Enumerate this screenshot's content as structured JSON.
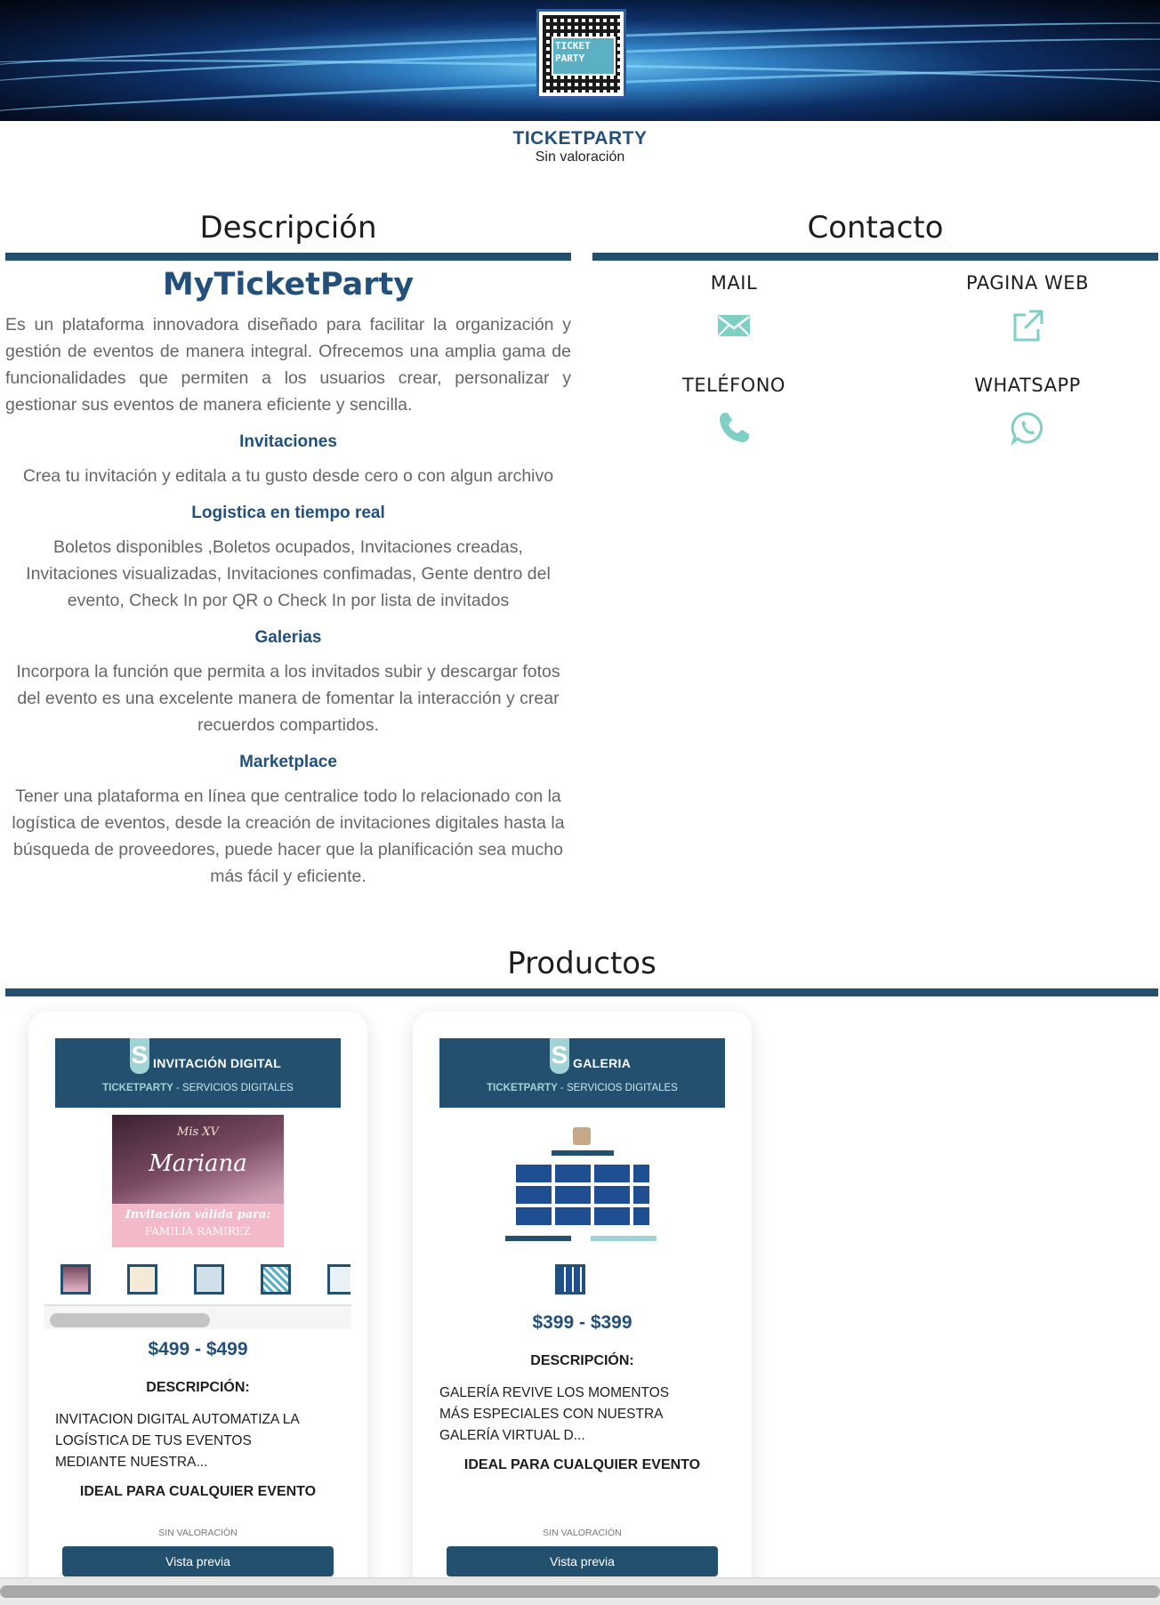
{
  "store": {
    "name": "TICKETPARTY",
    "rating": "Sin valoración"
  },
  "logo": {
    "line1": "TICKET",
    "line2": "PARTY"
  },
  "description": {
    "section_title": "Descripción",
    "brand": "MyTicketParty",
    "intro": "Es un plataforma innovadora diseñado para facilitar la organización y gestión de eventos de manera integral. Ofrecemos una amplia gama de funcionalidades que permiten a los usuarios crear, personalizar y gestionar sus eventos de manera eficiente y sencilla.",
    "features": [
      {
        "title": "Invitaciones",
        "text": "Crea tu invitación y editala a tu gusto desde cero o con algun archivo"
      },
      {
        "title": "Logistica en tiempo real",
        "text": "Boletos disponibles ,Boletos ocupados, Invitaciones creadas, Invitaciones visualizadas, Invitaciones confimadas, Gente dentro del evento, Check In por QR o Check In por lista de invitados"
      },
      {
        "title": "Galerias",
        "text": "Incorpora la función que permita a los invitados subir y descargar fotos del evento es una excelente manera de fomentar la interacción y crear recuerdos compartidos."
      },
      {
        "title": "Marketplace",
        "text": "Tener una plataforma en línea que centralice todo lo relacionado con la logística de eventos, desde la creación de invitaciones digitales hasta la búsqueda de proveedores, puede hacer que la planificación sea mucho más fácil y eficiente."
      }
    ]
  },
  "contact": {
    "section_title": "Contacto",
    "items": [
      {
        "label": "MAIL",
        "icon": "envelope-icon"
      },
      {
        "label": "PAGINA WEB",
        "icon": "external-link-icon"
      },
      {
        "label": "TELÉFONO",
        "icon": "phone-icon"
      },
      {
        "label": "WHATSAPP",
        "icon": "whatsapp-icon"
      }
    ]
  },
  "products": {
    "section_title": "Productos",
    "items": [
      {
        "banner_title": "INVITACIÓN DIGITAL",
        "banner_sub_brand": "TICKETPARTY",
        "banner_sub_rest": " - SERVICIOS DIGITALES",
        "image_text_1": "Mis XV",
        "image_text_2": "Mariana",
        "image_text_3": "Invitación válida para:",
        "image_text_4": "FAMILIA RAMIREZ",
        "price": "$499 - $499",
        "desc_label": "DESCRIPCIÓN:",
        "desc": "INVITACION DIGITAL AUTOMATIZA LA LOGÍSTICA DE TUS EVENTOS MEDIANTE NUESTRA...",
        "ideal": "IDEAL PARA CUALQUIER EVENTO",
        "rating": "SIN VALORACIÓN",
        "button": "Vista previa"
      },
      {
        "banner_title": "GALERIA",
        "banner_sub_brand": "TICKETPARTY",
        "banner_sub_rest": " - SERVICIOS DIGITALES",
        "price": "$399 - $399",
        "desc_label": "DESCRIPCIÓN:",
        "desc": "GALERÍA REVIVE LOS MOMENTOS MÁS ESPECIALES CON NUESTRA GALERÍA VIRTUAL D...",
        "ideal": "IDEAL PARA CUALQUIER EVENTO",
        "rating": "SIN VALORACIÓN",
        "button": "Vista previa"
      }
    ]
  },
  "colors": {
    "brand_dark_blue": "#24506f",
    "brand_title_blue": "#23507a",
    "accent_teal": "#7fcfc4"
  }
}
